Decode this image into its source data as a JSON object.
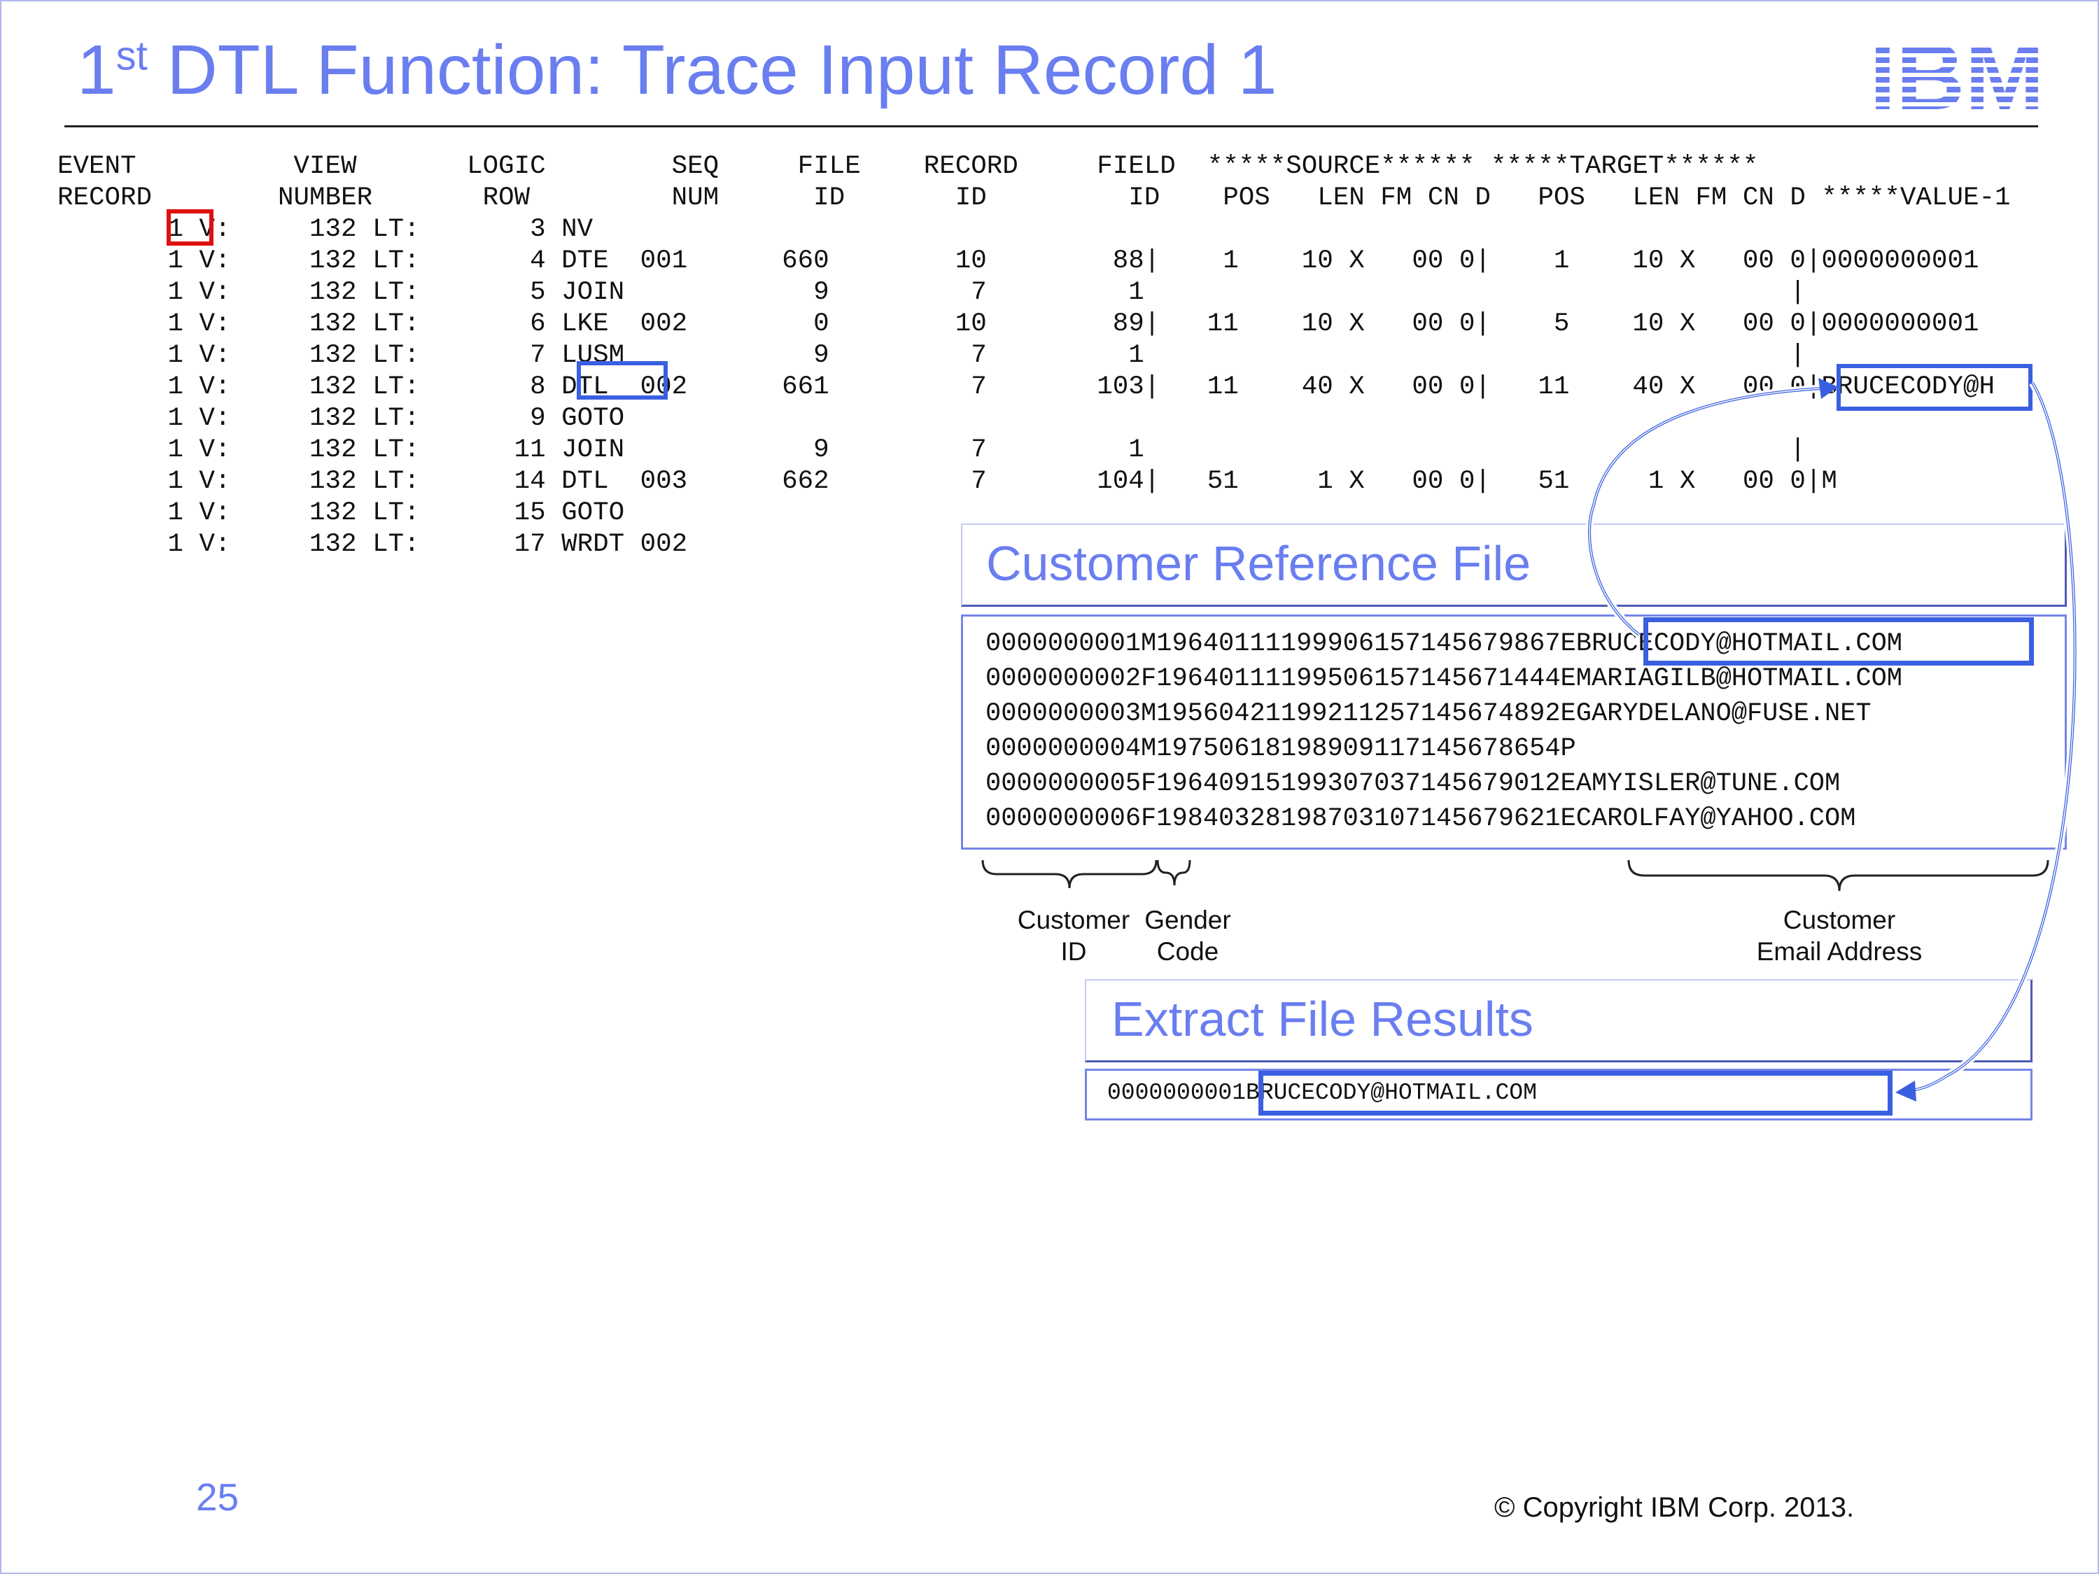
{
  "title": {
    "number": "1",
    "superscript": "st",
    "rest": " DTL Function: Trace Input Record 1"
  },
  "logo_text": "IBM",
  "trace": {
    "header_lines": [
      "EVENT          VIEW       LOGIC        SEQ     FILE    RECORD     FIELD  *****SOURCE****** *****TARGET******",
      "RECORD        NUMBER       ROW         NUM      ID       ID         ID    POS   LEN FM CN D   POS   LEN FM CN D *****VALUE-1"
    ],
    "rows": [
      "       1 V:     132 LT:       3 NV",
      "       1 V:     132 LT:       4 DTE  001      660        10        88|    1    10 X   00 0|    1    10 X   00 0|0000000001",
      "       1 V:     132 LT:       5 JOIN            9         7         1                                         |",
      "       1 V:     132 LT:       6 LKE  002        0        10        89|   11    10 X   00 0|    5    10 X   00 0|0000000001",
      "       1 V:     132 LT:       7 LUSM            9         7         1                                         |",
      "       1 V:     132 LT:       8 DTL  002      661         7       103|   11    40 X   00 0|   11    40 X   00 0|BRUCECODY@H",
      "       1 V:     132 LT:       9 GOTO",
      "       1 V:     132 LT:      11 JOIN            9         7         1                                         |",
      "       1 V:     132 LT:      14 DTL  003      662         7       104|   51     1 X   00 0|   51     1 X   00 0|M",
      "       1 V:     132 LT:      15 GOTO",
      "       1 V:     132 LT:      17 WRDT 002"
    ]
  },
  "customer_reference_file": {
    "title": "Customer Reference File",
    "lines": [
      "0000000001M19640111199906157145679867EBRUCECODY@HOTMAIL.COM",
      "0000000002F19640111199506157145671444EMARIAGILB@HOTMAIL.COM",
      "0000000003M19560421199211257145674892EGARYDELANO@FUSE.NET",
      "0000000004M19750618198909117145678654P",
      "0000000005F19640915199307037145679012EAMYISLER@TUNE.COM",
      "0000000006F19840328198703107145679621ECAROLFAY@YAHOO.COM"
    ],
    "labels": {
      "customer_id": "Customer\nID",
      "gender_code": "Gender\nCode",
      "email": "Customer\nEmail Address"
    }
  },
  "extract_file_results": {
    "title": "Extract File Results",
    "line": "0000000001BRUCECODY@HOTMAIL.COM"
  },
  "page_number": "25",
  "copyright": "© Copyright IBM Corp. 2013.",
  "colors": {
    "accent": "#6a7ef0",
    "highlight_blue": "#3a5fe0",
    "highlight_red": "#e01010",
    "rule": "#222222"
  }
}
